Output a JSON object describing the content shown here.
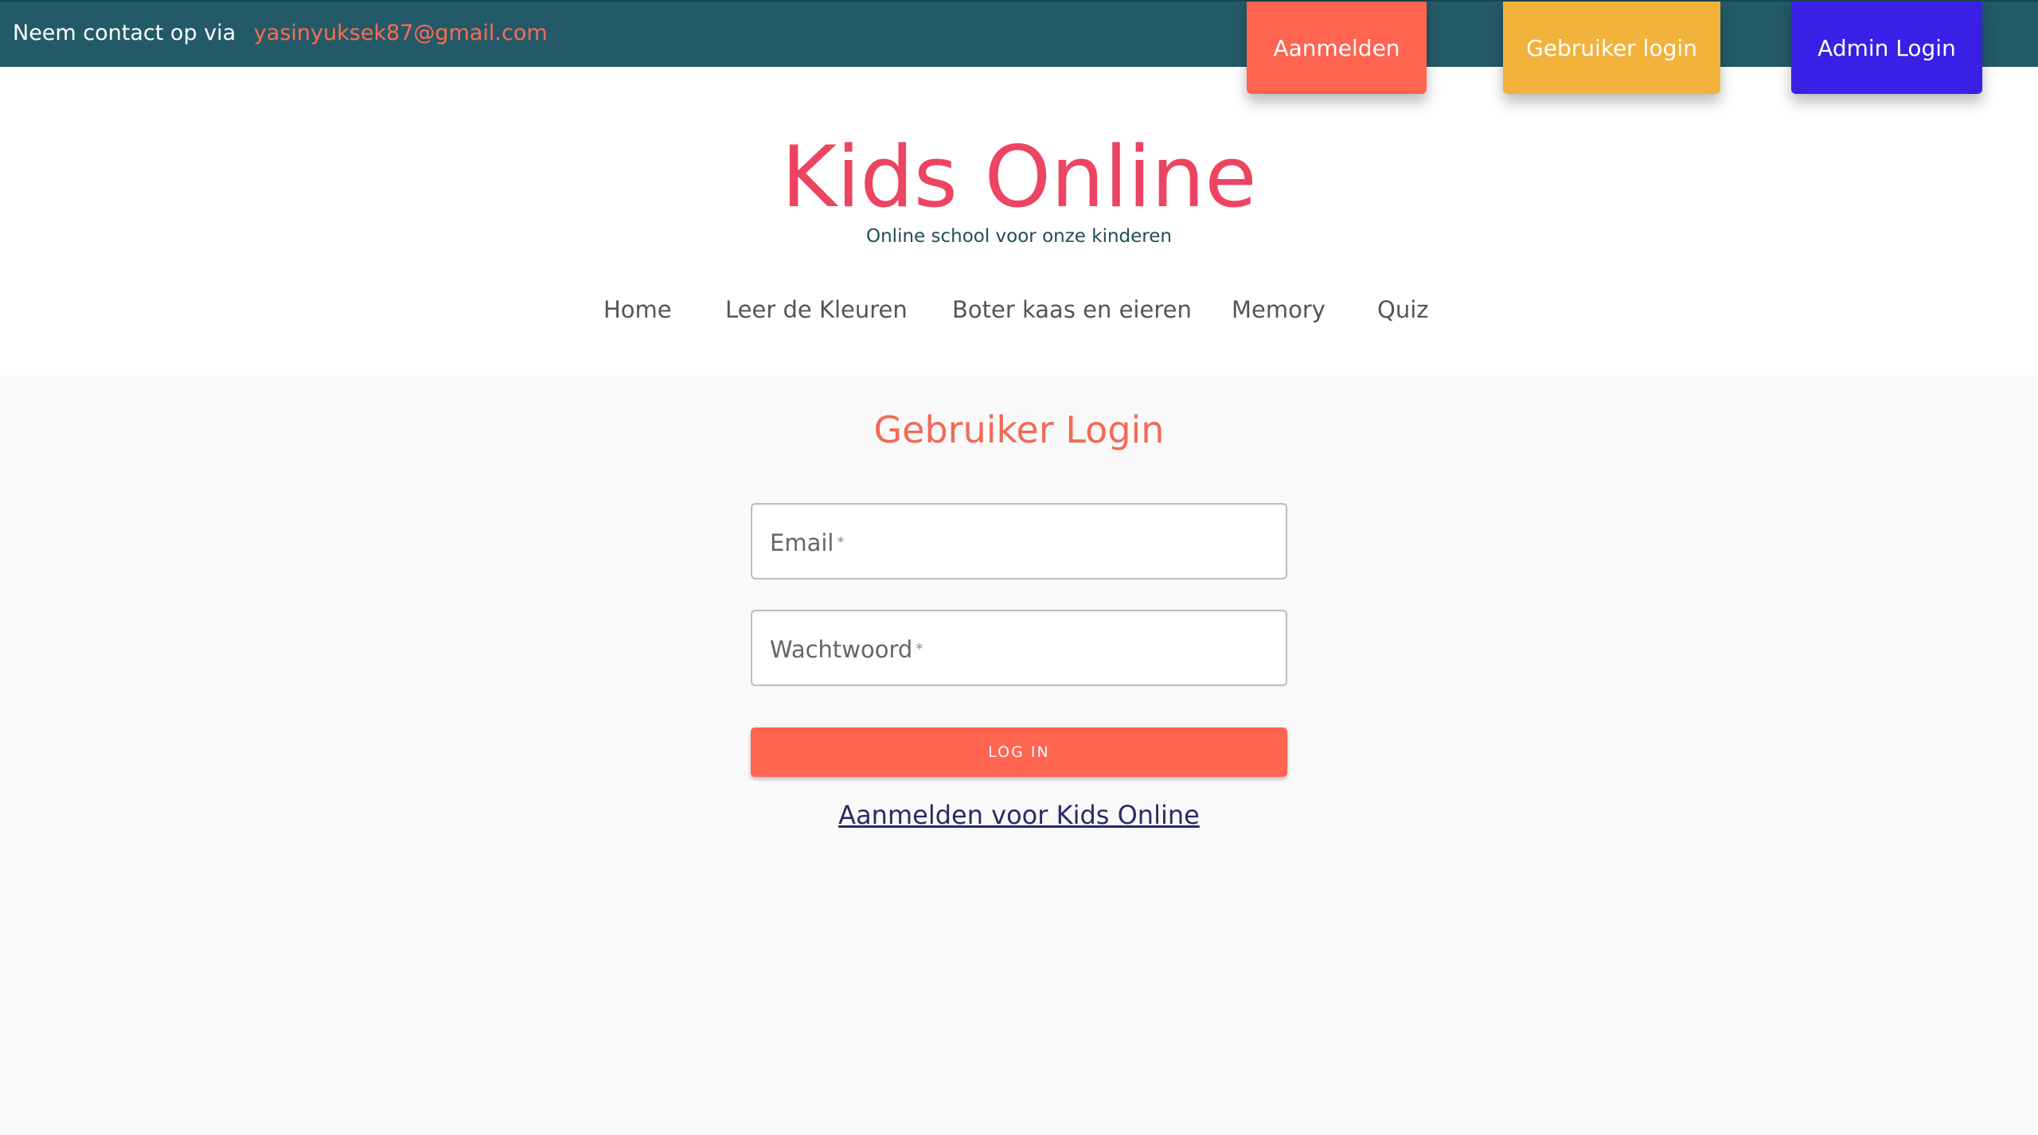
{
  "topbar": {
    "contact_text": "Neem contact op via",
    "contact_email": "yasinyuksek87@gmail.com",
    "buttons": {
      "signup": "Aanmelden",
      "user_login": "Gebruiker login",
      "admin_login": "Admin Login"
    }
  },
  "header": {
    "brand": "Kids Online",
    "tagline": "Online school voor onze kinderen",
    "nav": [
      "Home",
      "Leer de Kleuren",
      "Boter kaas en eieren",
      "Memory",
      "Quiz"
    ]
  },
  "login": {
    "title": "Gebruiker Login",
    "email_label": "Email",
    "password_label": "Wachtwoord",
    "required_mark": "*",
    "submit_label": "LOG IN",
    "signup_link": "Aanmelden voor Kids Online"
  },
  "colors": {
    "topbar": "#235a68",
    "brand": "#ec4461",
    "accent": "#ff6450",
    "user_button": "#f2b33c",
    "admin_button": "#3c1fe6"
  }
}
